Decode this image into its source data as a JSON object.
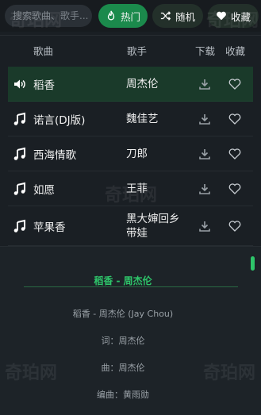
{
  "search": {
    "placeholder": "搜索歌曲、歌手..."
  },
  "buttons": {
    "hot": "热门",
    "random": "随机",
    "favorites": "收藏"
  },
  "table": {
    "headers": {
      "song": "歌曲",
      "artist": "歌手",
      "download": "下载",
      "favorite": "收藏"
    },
    "rows": [
      {
        "title": "稻香",
        "artist": "周杰伦",
        "playing": true
      },
      {
        "title": "诺言(DJ版)",
        "artist": "魏佳艺",
        "playing": false
      },
      {
        "title": "西海情歌",
        "artist": "刀郎",
        "playing": false
      },
      {
        "title": "如愿",
        "artist": "王菲",
        "playing": false
      },
      {
        "title": "苹果香",
        "artist": "黑大婶回乡带娃",
        "playing": false
      }
    ]
  },
  "lyrics": {
    "title": "稻香 - 周杰伦",
    "lines": [
      "稻香 - 周杰伦 (Jay Chou)",
      "词：周杰伦",
      "曲：周杰伦",
      "编曲：黄雨勋"
    ]
  },
  "watermark": "奇珀网",
  "colors": {
    "accent": "#1b8a4c",
    "accent_text": "#2ec56a",
    "active_row": "#1a3a2a",
    "background": "#1a1f24"
  },
  "icons": [
    "speaker-icon",
    "music-note-icon",
    "download-icon",
    "heart-icon",
    "flame-icon",
    "shuffle-icon"
  ]
}
